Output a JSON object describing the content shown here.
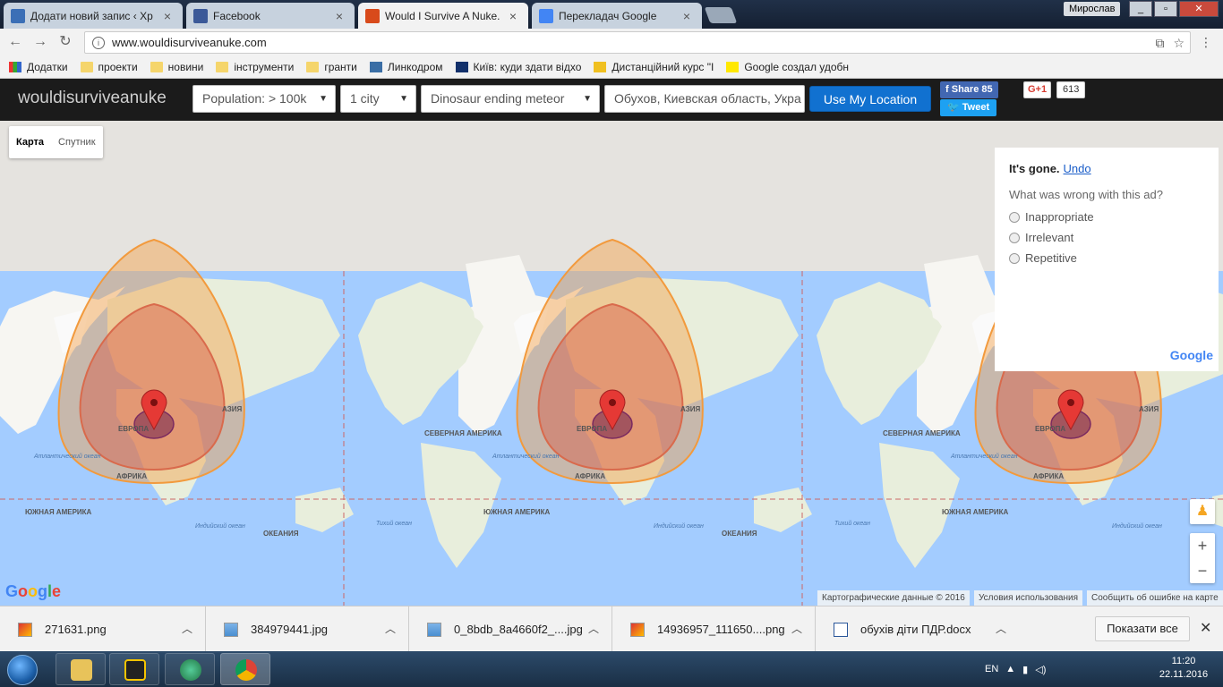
{
  "browser": {
    "tabs": [
      {
        "label": "Додати новий запис ‹ Хр",
        "icon_color": "#3b6fb6"
      },
      {
        "label": "Facebook",
        "icon_color": "#3b5998"
      },
      {
        "label": "Would I Survive A Nuke.",
        "icon_color": "#d84a1b"
      },
      {
        "label": "Перекладач Google",
        "icon_color": "#4285f4"
      }
    ],
    "user": "Мирослав",
    "url": "www.wouldisurviveanuke.com",
    "bookmarks": [
      {
        "label": "Додатки",
        "icon": "apps-icon"
      },
      {
        "label": "проекти",
        "icon": "folder-icon"
      },
      {
        "label": "новини",
        "icon": "folder-icon"
      },
      {
        "label": "інструменти",
        "icon": "folder-icon"
      },
      {
        "label": "гранти",
        "icon": "folder-icon"
      },
      {
        "label": "Линкодром",
        "icon": "bookmark-icon"
      },
      {
        "label": "Київ: куди здати відхо",
        "icon": "bookmark-icon"
      },
      {
        "label": "Дистанційний курс \"І",
        "icon": "bookmark-icon"
      },
      {
        "label": "Google создал удобн",
        "icon": "bookmark-icon"
      }
    ]
  },
  "site": {
    "logo": "wouldisurviveanuke",
    "population": "Population: > 100k",
    "city_count": "1 city",
    "weapon": "Dinosaur ending meteor",
    "location": "Обухов, Киевская область, Укра",
    "use_location": "Use My Location",
    "fb_share": "Share 85",
    "tweet": "Tweet",
    "gplus": "G+1",
    "gplus_count": "613"
  },
  "map": {
    "type_map": "Карта",
    "type_satellite": "Спутник",
    "labels": {
      "europe": "ЕВРОПА",
      "asia": "АЗИЯ",
      "africa": "АФРИКА",
      "north_america": "СЕВЕРНАЯ АМЕРИКА",
      "south_america": "ЮЖНАЯ АМЕРИКА",
      "oceania": "ОКЕАНИЯ",
      "atlantic": "Атлантический океан",
      "indian": "Индийский океан",
      "pacific": "Тихий океан"
    },
    "attribution": [
      "Картографические данные © 2016",
      "Условия использования",
      "Сообщить об ошибке на карте"
    ],
    "google": "Google"
  },
  "ad": {
    "gone": "It's gone.",
    "undo": "Undo",
    "question": "What was wrong with this ad?",
    "options": [
      "Inappropriate",
      "Irrelevant",
      "Repetitive"
    ],
    "brand": "Google"
  },
  "downloads": {
    "items": [
      "271631.png",
      "384979441.jpg",
      "0_8bdb_8a4660f2_....jpg",
      "14936957_111650....png",
      "обухів діти ПДР.docx"
    ],
    "show_all": "Показати все"
  },
  "taskbar": {
    "lang": "EN",
    "time": "11:20",
    "date": "22.11.2016"
  }
}
